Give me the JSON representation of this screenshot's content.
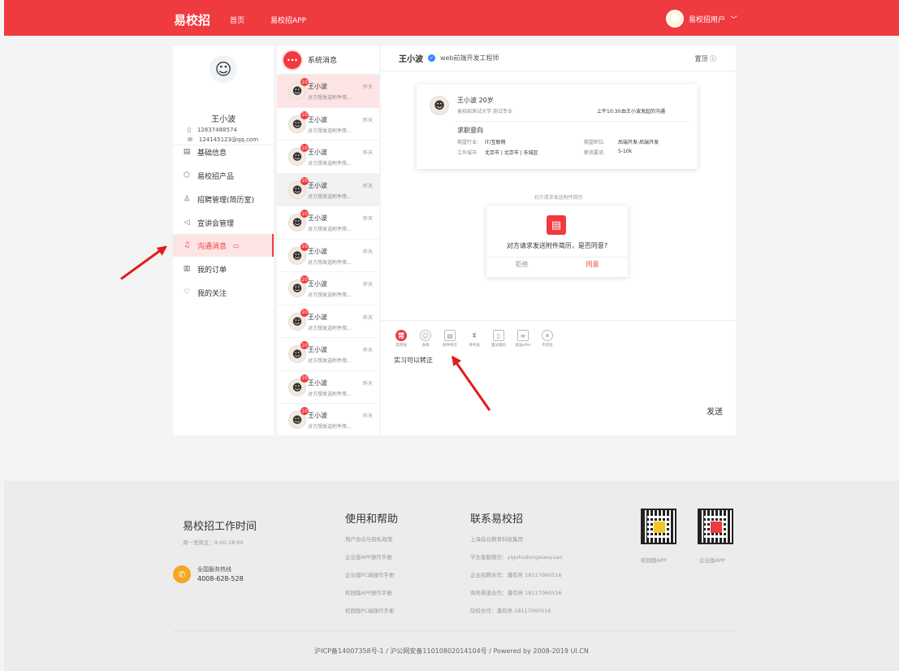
{
  "header": {
    "brand": "易校招",
    "nav": [
      "首页",
      "易校招APP"
    ],
    "user": "易校招用户"
  },
  "profile": {
    "name": "王小波",
    "phone": "12837488574",
    "email": "124145123@qq.com"
  },
  "menu": [
    {
      "label": "基础信息",
      "icon": "document-icon"
    },
    {
      "label": "易校招产品",
      "icon": "cube-icon"
    },
    {
      "label": "招聘管理(简历室)",
      "icon": "person-icon"
    },
    {
      "label": "宣讲会管理",
      "icon": "speaker-icon"
    },
    {
      "label": "沟通消息",
      "icon": "bell-icon",
      "active": true
    },
    {
      "label": "我的订单",
      "icon": "order-icon"
    },
    {
      "label": "我的关注",
      "icon": "heart-icon"
    }
  ],
  "system_label": "系统消息",
  "conversation": {
    "name": "王小波",
    "time": "昨天",
    "msg": "对方想发送附件简...",
    "badge": "10",
    "count": 12
  },
  "chat": {
    "name": "王小波",
    "role": "web前端开发工程师",
    "top": "置顶",
    "card": {
      "name_age": "王小波  20岁",
      "school": "易校招测试大学  测试专业",
      "time": "上午10:30",
      "initiator": "由王小波发起的沟通",
      "intent": "求职意向",
      "industry_label": "期望行业:",
      "industry": "IT/互联网",
      "position_label": "期望职位:",
      "position": "后端开发-后端开发",
      "city_label": "工作城市:",
      "city": "北京市 | 北京市 | 东城区",
      "salary_label": "薪资要求:",
      "salary": "5-10k"
    },
    "notice": "对方请求发送附件简历",
    "request": {
      "text": "对方请求发送附件简历，是否同意?",
      "reject": "拒绝",
      "agree": "同意"
    },
    "tools": [
      "常用语",
      "表情",
      "附件简历",
      "待考虑",
      "面试邀约",
      "发送offer",
      "不适合"
    ],
    "input": "实习可以转正",
    "send": "发送"
  },
  "footer": {
    "time_title": "易校招工作时间",
    "time": "周一至周五：9:00-18:00",
    "hotline_label": "全国服务热线",
    "hotline": "4008-628-528",
    "help_title": "使用和帮助",
    "help": [
      "用户协议与隐私政策",
      "企业版APP操作手册",
      "企业版PC端操作手册",
      "校园版APP操作手册",
      "校园版PC端操作手册"
    ],
    "contact_title": "联系易校招",
    "contact": [
      "上海岳谷教育科技集团",
      "学生客服微信：yiguhudongxiaoyuan",
      "企业招聘合作：潘有亮 18117060516",
      "商务渠道合作：潘有亮 18117060516",
      "院校合作：潘有亮 18117060516"
    ],
    "qr": [
      "校园版APP",
      "企业版APP"
    ],
    "copyright": "沪ICP备14007358号-1 / 沪公网安备11010802014104号 / Powered by 2008-2019 UI.CN"
  },
  "colors": {
    "brand": "#ef3a3f",
    "arrow": "#e41b1b"
  }
}
